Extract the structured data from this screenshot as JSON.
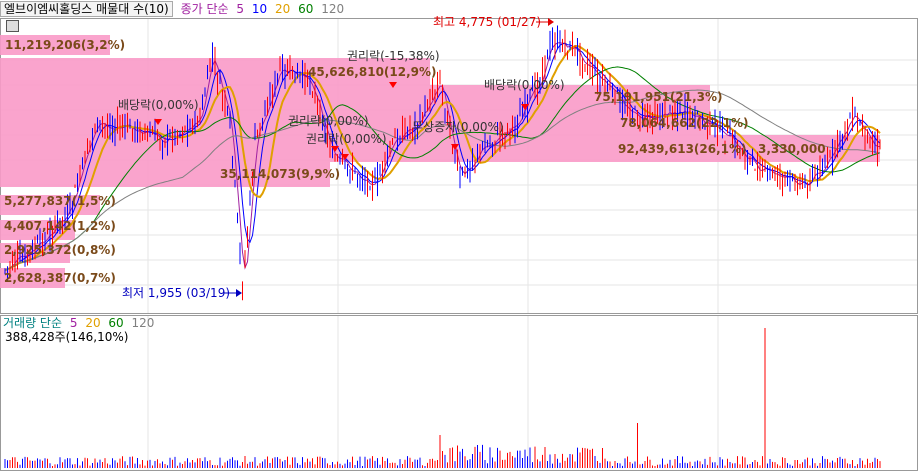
{
  "header": {
    "stock_label": "엘브이엠씨홀딩스 매물대 수(10)",
    "ma_label": "종가 단순",
    "ma_periods": [
      "5",
      "10",
      "20",
      "60",
      "120"
    ],
    "ma_colors": [
      "#a020a0",
      "#0000ff",
      "#e0a000",
      "#008000",
      "#808080"
    ]
  },
  "volume_header": {
    "label": "거래량 단순",
    "label_color": "#008080",
    "periods": [
      "5",
      "20",
      "60",
      "120"
    ],
    "period_colors": [
      "#a020a0",
      "#e0a000",
      "#008000",
      "#808080"
    ],
    "current": "388,428주(146,10%)"
  },
  "chart_data": {
    "type": "candlestick",
    "title": "엘브이엠씨홀딩스",
    "price_range": [
      1800,
      4900
    ],
    "high_label": "최고 4,775 (01/27)",
    "low_label": "최저 1,955 (03/19)",
    "volume_profile": [
      {
        "label": "11,219,206(3,2%)"
      },
      {
        "label": "45,626,810(12,9%)"
      },
      {
        "label": "75,191,951(21,3%)"
      },
      {
        "label": "78,064,662(22,1%)"
      },
      {
        "label": "92,439,613(26,1%)"
      },
      {
        "label": "35,114,073(9,9%)"
      },
      {
        "label": "5,277,837(1,5%)"
      },
      {
        "label": "4,407,142(1,2%)"
      },
      {
        "label": "2,925,372(0,8%)"
      },
      {
        "label": "2,628,387(0,7%)"
      }
    ],
    "events": [
      {
        "label": "배당락(0,00%)"
      },
      {
        "label": "권리락(-15,38%)"
      },
      {
        "label": "권리락(0,00%)"
      },
      {
        "label": "권리락(0,00%)"
      },
      {
        "label": "무상증자(0,00%)"
      },
      {
        "label": "배당락(0,00%)"
      }
    ],
    "current_price_label": "3,330,000"
  }
}
